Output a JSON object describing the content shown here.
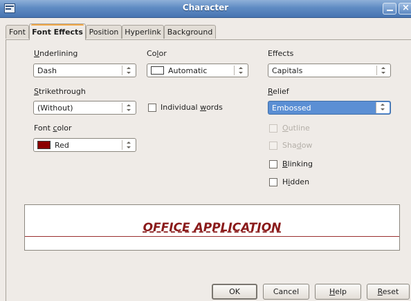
{
  "window": {
    "title": "Character"
  },
  "tabs": [
    {
      "label": "Font"
    },
    {
      "label": "Font Effects"
    },
    {
      "label": "Position"
    },
    {
      "label": "Hyperlink"
    },
    {
      "label": "Background"
    }
  ],
  "underlining": {
    "label_u": "U",
    "label_rest": "nderlining",
    "value": "Dash"
  },
  "color": {
    "label_a": "Co",
    "label_u": "l",
    "label_b": "or",
    "value": "Automatic",
    "swatch": "#ffffff"
  },
  "effects": {
    "label": "Effects",
    "value": "Capitals"
  },
  "strikethrough": {
    "label_u": "S",
    "label_rest": "trikethrough",
    "value": "(Without)"
  },
  "individual_words": {
    "label_a": "Individual ",
    "label_u": "w",
    "label_b": "ords",
    "checked": false
  },
  "relief": {
    "label_u": "R",
    "label_rest": "elief",
    "value": "Embossed"
  },
  "font_color": {
    "label_a": "Font ",
    "label_u": "c",
    "label_b": "olor",
    "value": "Red",
    "swatch": "#8b0000"
  },
  "outline": {
    "label_u": "O",
    "label_rest": "utline",
    "checked": false,
    "enabled": false
  },
  "shadow": {
    "label_a": "Sha",
    "label_u": "d",
    "label_b": "ow",
    "checked": false,
    "enabled": false
  },
  "blinking": {
    "label_u": "B",
    "label_rest": "linking",
    "checked": false
  },
  "hidden": {
    "label_a": "H",
    "label_u": "i",
    "label_b": "dden",
    "checked": false
  },
  "preview": {
    "text": "OFFICE APPLICATION",
    "color": "#8a1a1a"
  },
  "buttons": {
    "ok": "OK",
    "cancel": "Cancel",
    "help_u": "H",
    "help_rest": "elp",
    "reset_u": "R",
    "reset_rest": "eset"
  },
  "colors": {
    "titlebar": "#5f8bc3",
    "dialog_bg": "#efebe7",
    "selection": "#5b8fd4",
    "tab_accent": "#f3a947"
  }
}
